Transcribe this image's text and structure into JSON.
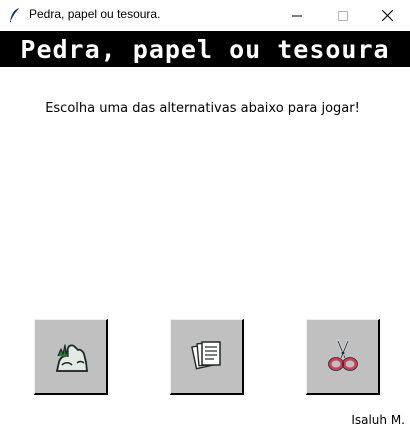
{
  "window": {
    "title": "Pedra, papel ou tesoura.",
    "app_icon": "feather-icon",
    "controls": [
      "minimize-icon",
      "maximize-icon",
      "close-icon"
    ]
  },
  "banner": {
    "title": "Pedra, papel ou tesoura",
    "background": "#000000",
    "color": "#ffffff"
  },
  "instruction": "Escolha uma das alternativas abaixo para jogar!",
  "choices": [
    {
      "icon": "rock-icon"
    },
    {
      "icon": "paper-icon"
    },
    {
      "icon": "scissors-icon"
    }
  ],
  "choice_button_color": "#c0c0c0",
  "author": "Isaluh M."
}
